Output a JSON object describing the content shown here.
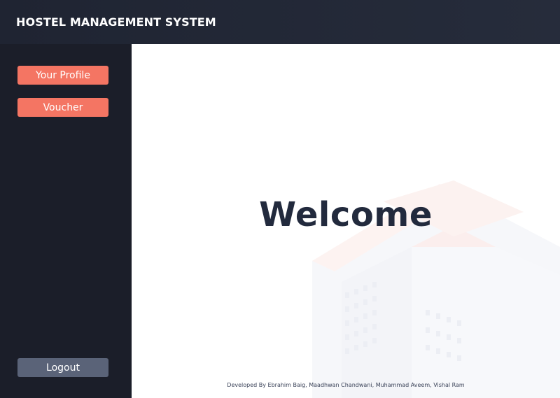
{
  "header": {
    "title": "HOSTEL MANAGEMENT SYSTEM"
  },
  "sidebar": {
    "buttons": [
      {
        "label": "Your Profile"
      },
      {
        "label": "Voucher"
      }
    ],
    "logout_label": "Logout"
  },
  "main": {
    "welcome_text": "Welcome",
    "footer_text": "Developed By Ebrahim Baig, Maadhwan Chandwani, Muhammad Aveem, Vishal Ram"
  },
  "colors": {
    "header_bg": "#1f2432",
    "sidebar_bg": "#1b1e29",
    "primary_button": "#f47563",
    "logout_button": "#5a6378",
    "welcome_text": "#222a3d"
  }
}
